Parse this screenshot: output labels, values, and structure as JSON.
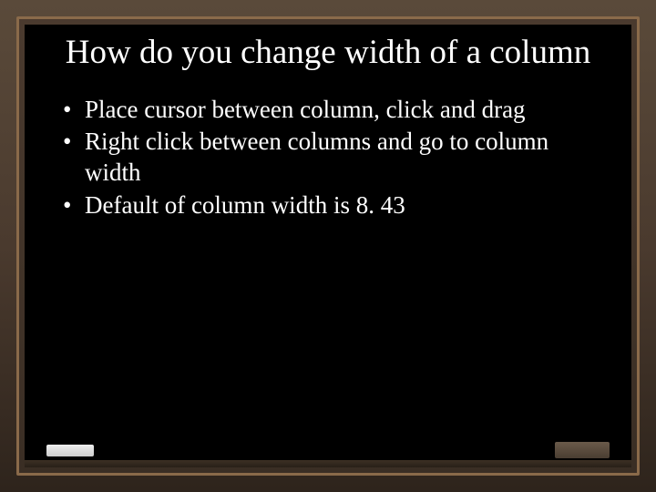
{
  "slide": {
    "title": "How do you change width of a column",
    "bullets": [
      "Place cursor between column, click and drag",
      "Right click between columns and go to column width",
      "Default of column width is 8. 43"
    ]
  }
}
